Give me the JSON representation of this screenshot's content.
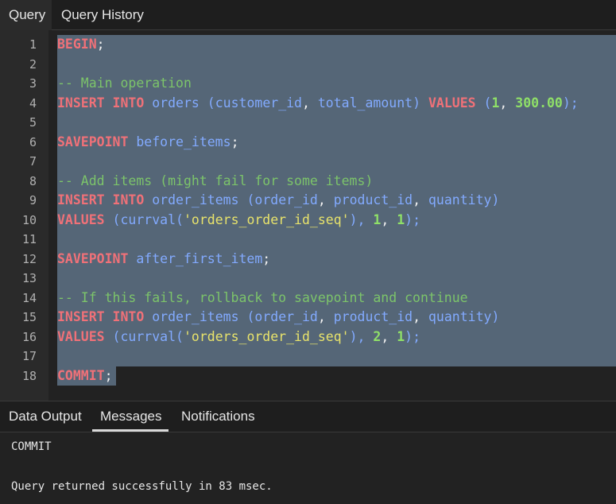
{
  "top_tabs": [
    {
      "label": "Query",
      "active": true
    },
    {
      "label": "Query History",
      "active": false
    }
  ],
  "editor": {
    "line_numbers": [
      "1",
      "2",
      "3",
      "4",
      "5",
      "6",
      "7",
      "8",
      "9",
      "10",
      "11",
      "12",
      "13",
      "14",
      "15",
      "16",
      "17",
      "18"
    ],
    "lines": [
      "BEGIN;",
      "",
      "-- Main operation",
      "INSERT INTO orders (customer_id, total_amount) VALUES (1, 300.00);",
      "",
      "SAVEPOINT before_items;",
      "",
      "-- Add items (might fail for some items)",
      "INSERT INTO order_items (order_id, product_id, quantity)",
      "VALUES (currval('orders_order_id_seq'), 1, 1);",
      "",
      "SAVEPOINT after_first_item;",
      "",
      "-- If this fails, rollback to savepoint and continue",
      "INSERT INTO order_items (order_id, product_id, quantity)",
      "VALUES (currval('orders_order_id_seq'), 2, 1);",
      "",
      "COMMIT;"
    ],
    "selected_all": true
  },
  "bottom_tabs": [
    {
      "label": "Data Output",
      "active": false
    },
    {
      "label": "Messages",
      "active": true
    },
    {
      "label": "Notifications",
      "active": false
    }
  ],
  "messages": {
    "line1": "COMMIT",
    "line2": "Query returned successfully in 83 msec."
  },
  "colors": {
    "keyword": "#f07178",
    "identifier": "#82aaff",
    "comment": "#7cc46a",
    "number": "#8fe068",
    "string": "#e8e36b",
    "selection": "#556677"
  }
}
